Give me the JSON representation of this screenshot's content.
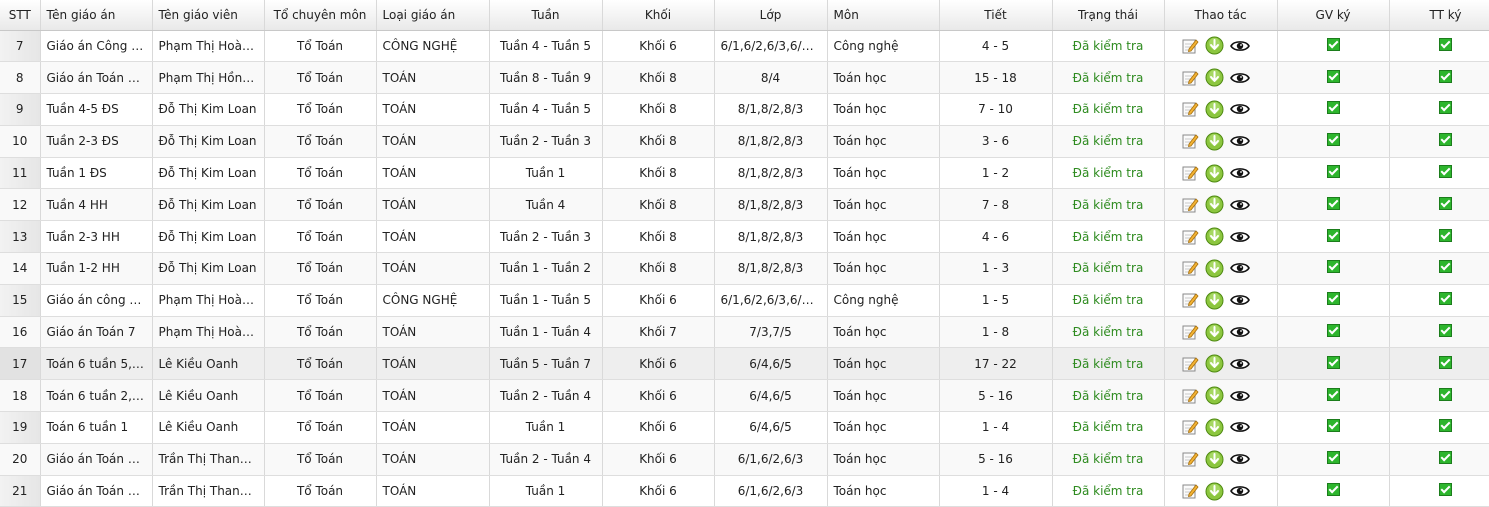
{
  "columns": {
    "stt": "STT",
    "ten_giao_an": "Tên giáo án",
    "ten_giao_vien": "Tên giáo viên",
    "to_chuyen_mon": "Tổ chuyên môn",
    "loai_giao_an": "Loại giáo án",
    "tuan": "Tuần",
    "khoi": "Khối",
    "lop": "Lớp",
    "mon": "Môn",
    "tiet": "Tiết",
    "trang_thai": "Trạng thái",
    "thao_tac": "Thao tác",
    "gv_ky": "GV ký",
    "tt_ky": "TT ký"
  },
  "colors": {
    "status": "#2e8b1f",
    "check": "#2db52d",
    "download": "#8cc63f"
  },
  "icons": {
    "edit": "edit-icon",
    "download": "download-icon",
    "view": "eye-icon",
    "checked": "checkbox-checked-icon"
  },
  "rows": [
    {
      "stt": "7",
      "ten": "Giáo án Công N...",
      "gv": "Phạm Thị Hoàn...",
      "to": "Tổ Toán",
      "loai": "CÔNG NGHỆ",
      "tuan": "Tuần 4 - Tuần 5",
      "khoi": "Khối 6",
      "lop": "6/1,6/2,6/3,6/4,...",
      "mon": "Công nghệ",
      "tiet": "4 - 5",
      "trang_thai": "Đã kiểm tra"
    },
    {
      "stt": "8",
      "ten": "Giáo án Toán 8 ...",
      "gv": "Phạm Thị Hồng ...",
      "to": "Tổ Toán",
      "loai": "TOÁN",
      "tuan": "Tuần 8 - Tuần 9",
      "khoi": "Khối 8",
      "lop": "8/4",
      "mon": "Toán học",
      "tiet": "15 - 18",
      "trang_thai": "Đã kiểm tra"
    },
    {
      "stt": "9",
      "ten": "Tuần 4-5 ĐS",
      "gv": "Đỗ Thị Kim Loan",
      "to": "Tổ Toán",
      "loai": "TOÁN",
      "tuan": "Tuần 4 - Tuần 5",
      "khoi": "Khối 8",
      "lop": "8/1,8/2,8/3",
      "mon": "Toán học",
      "tiet": "7 - 10",
      "trang_thai": "Đã kiểm tra"
    },
    {
      "stt": "10",
      "ten": "Tuần 2-3 ĐS",
      "gv": "Đỗ Thị Kim Loan",
      "to": "Tổ Toán",
      "loai": "TOÁN",
      "tuan": "Tuần 2 - Tuần 3",
      "khoi": "Khối 8",
      "lop": "8/1,8/2,8/3",
      "mon": "Toán học",
      "tiet": "3 - 6",
      "trang_thai": "Đã kiểm tra"
    },
    {
      "stt": "11",
      "ten": "Tuần 1 ĐS",
      "gv": "Đỗ Thị Kim Loan",
      "to": "Tổ Toán",
      "loai": "TOÁN",
      "tuan": "Tuần 1",
      "khoi": "Khối 8",
      "lop": "8/1,8/2,8/3",
      "mon": "Toán học",
      "tiet": "1 - 2",
      "trang_thai": "Đã kiểm tra"
    },
    {
      "stt": "12",
      "ten": "Tuần 4 HH",
      "gv": "Đỗ Thị Kim Loan",
      "to": "Tổ Toán",
      "loai": "TOÁN",
      "tuan": "Tuần 4",
      "khoi": "Khối 8",
      "lop": "8/1,8/2,8/3",
      "mon": "Toán học",
      "tiet": "7 - 8",
      "trang_thai": "Đã kiểm tra"
    },
    {
      "stt": "13",
      "ten": "Tuần 2-3 HH",
      "gv": "Đỗ Thị Kim Loan",
      "to": "Tổ Toán",
      "loai": "TOÁN",
      "tuan": "Tuần 2 - Tuần 3",
      "khoi": "Khối 8",
      "lop": "8/1,8/2,8/3",
      "mon": "Toán học",
      "tiet": "4 - 6",
      "trang_thai": "Đã kiểm tra"
    },
    {
      "stt": "14",
      "ten": "Tuần 1-2 HH",
      "gv": "Đỗ Thị Kim Loan",
      "to": "Tổ Toán",
      "loai": "TOÁN",
      "tuan": "Tuần 1 - Tuần 2",
      "khoi": "Khối 8",
      "lop": "8/1,8/2,8/3",
      "mon": "Toán học",
      "tiet": "1 - 3",
      "trang_thai": "Đã kiểm tra"
    },
    {
      "stt": "15",
      "ten": "Giáo án công n...",
      "gv": "Phạm Thị Hoàn...",
      "to": "Tổ Toán",
      "loai": "CÔNG NGHỆ",
      "tuan": "Tuần 1 - Tuần 5",
      "khoi": "Khối 6",
      "lop": "6/1,6/2,6/3,6/4,...",
      "mon": "Công nghệ",
      "tiet": "1 - 5",
      "trang_thai": "Đã kiểm tra"
    },
    {
      "stt": "16",
      "ten": "Giáo án Toán 7",
      "gv": "Phạm Thị Hoàn...",
      "to": "Tổ Toán",
      "loai": "TOÁN",
      "tuan": "Tuần 1 - Tuần 4",
      "khoi": "Khối 7",
      "lop": "7/3,7/5",
      "mon": "Toán học",
      "tiet": "1 - 8",
      "trang_thai": "Đã kiểm tra"
    },
    {
      "stt": "17",
      "ten": "Toán 6 tuần 5,6,7",
      "gv": "Lê Kiều Oanh",
      "to": "Tổ Toán",
      "loai": "TOÁN",
      "tuan": "Tuần 5 - Tuần 7",
      "khoi": "Khối 6",
      "lop": "6/4,6/5",
      "mon": "Toán học",
      "tiet": "17 - 22",
      "trang_thai": "Đã kiểm tra"
    },
    {
      "stt": "18",
      "ten": "Toán 6 tuần 2,3,4",
      "gv": "Lê Kiều Oanh",
      "to": "Tổ Toán",
      "loai": "TOÁN",
      "tuan": "Tuần 2 - Tuần 4",
      "khoi": "Khối 6",
      "lop": "6/4,6/5",
      "mon": "Toán học",
      "tiet": "5 - 16",
      "trang_thai": "Đã kiểm tra"
    },
    {
      "stt": "19",
      "ten": "Toán 6 tuần 1",
      "gv": "Lê Kiều Oanh",
      "to": "Tổ Toán",
      "loai": "TOÁN",
      "tuan": "Tuần 1",
      "khoi": "Khối 6",
      "lop": "6/4,6/5",
      "mon": "Toán học",
      "tiet": "1 - 4",
      "trang_thai": "Đã kiểm tra"
    },
    {
      "stt": "20",
      "ten": "Giáo án Toán 6 ...",
      "gv": "Trần Thị Thanh ...",
      "to": "Tổ Toán",
      "loai": "TOÁN",
      "tuan": "Tuần 2 - Tuần 4",
      "khoi": "Khối 6",
      "lop": "6/1,6/2,6/3",
      "mon": "Toán học",
      "tiet": "5 - 16",
      "trang_thai": "Đã kiểm tra"
    },
    {
      "stt": "21",
      "ten": "Giáo án Toán 6 ...",
      "gv": "Trần Thị Thanh ...",
      "to": "Tổ Toán",
      "loai": "TOÁN",
      "tuan": "Tuần 1",
      "khoi": "Khối 6",
      "lop": "6/1,6/2,6/3",
      "mon": "Toán học",
      "tiet": "1 - 4",
      "trang_thai": "Đã kiểm tra"
    }
  ]
}
